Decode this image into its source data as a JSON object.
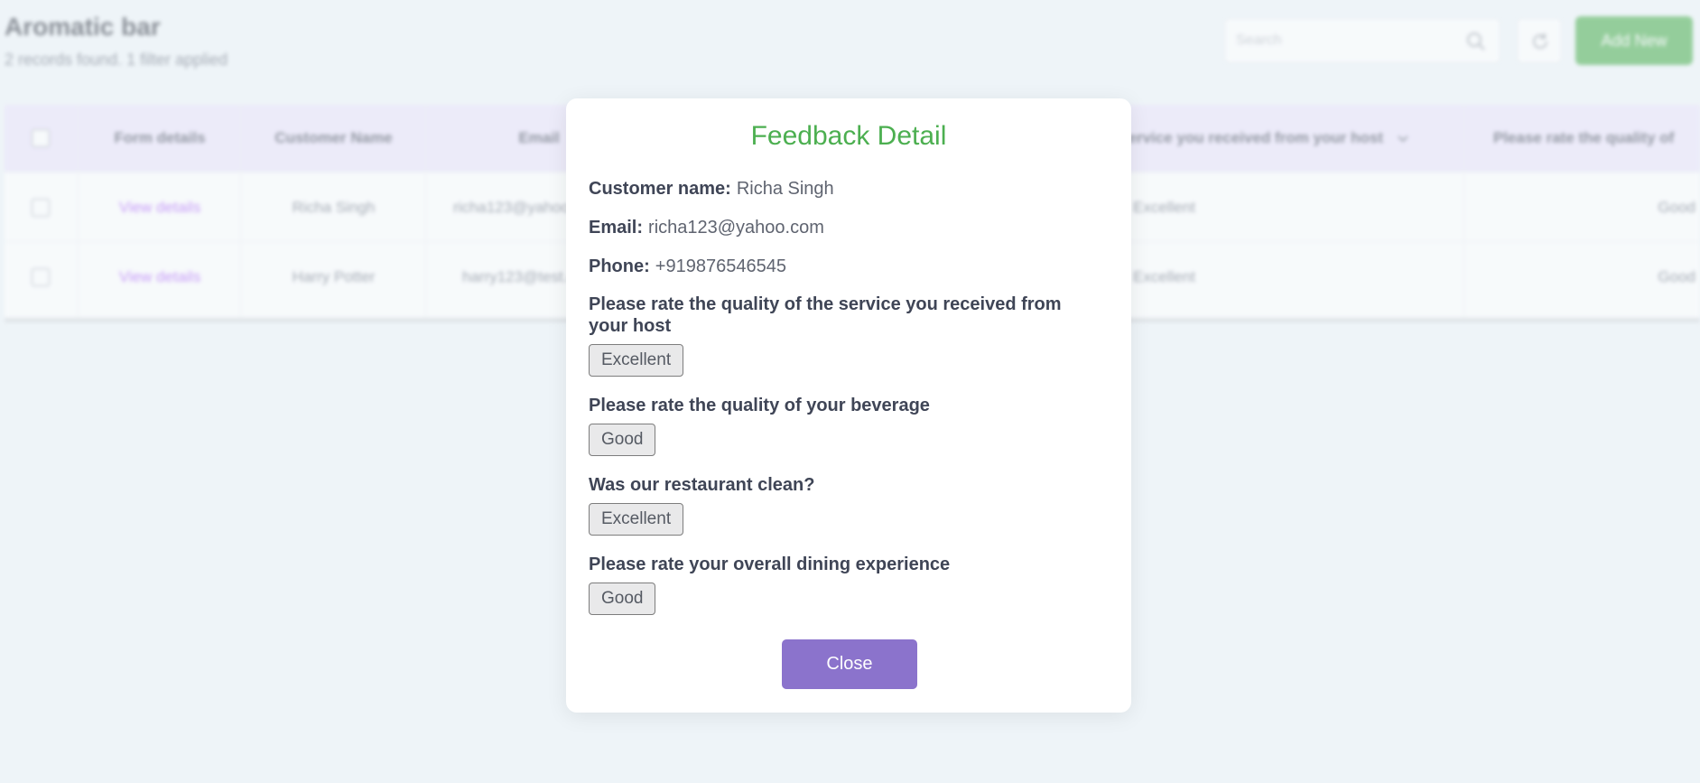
{
  "page": {
    "title": "Aromatic bar",
    "subtitle": "2 records found. 1 filter applied",
    "search_placeholder": "Search",
    "add_button": "Add New"
  },
  "table": {
    "columns": [
      "Form details",
      "Customer Name",
      "Email",
      "Please rate the quality of the service you received from your host",
      "Please rate the quality of"
    ],
    "rows": [
      {
        "link": "View details",
        "name": "Richa Singh",
        "email": "richa123@yahoo.com",
        "host": "Excellent",
        "beverage": "Good"
      },
      {
        "link": "View details",
        "name": "Harry Potter",
        "email": "harry123@test.com",
        "host": "Excellent",
        "beverage": "Good"
      }
    ]
  },
  "modal": {
    "title": "Feedback Detail",
    "customer_label": "Customer name:",
    "customer_value": "Richa Singh",
    "email_label": "Email:",
    "email_value": "richa123@yahoo.com",
    "phone_label": "Phone:",
    "phone_value": "+919876546545",
    "questions": [
      {
        "q": "Please rate the quality of the service you received from your host",
        "a": "Excellent"
      },
      {
        "q": "Please rate the quality of your beverage",
        "a": "Good"
      },
      {
        "q": "Was our restaurant clean?",
        "a": "Excellent"
      },
      {
        "q": "Please rate your overall dining experience",
        "a": "Good"
      }
    ],
    "close_button": "Close"
  },
  "colors": {
    "accent_green": "#4caf50",
    "close_purple": "#8b73cc",
    "link_purple": "#a855f7",
    "header_lavender": "#ebe4fb"
  }
}
